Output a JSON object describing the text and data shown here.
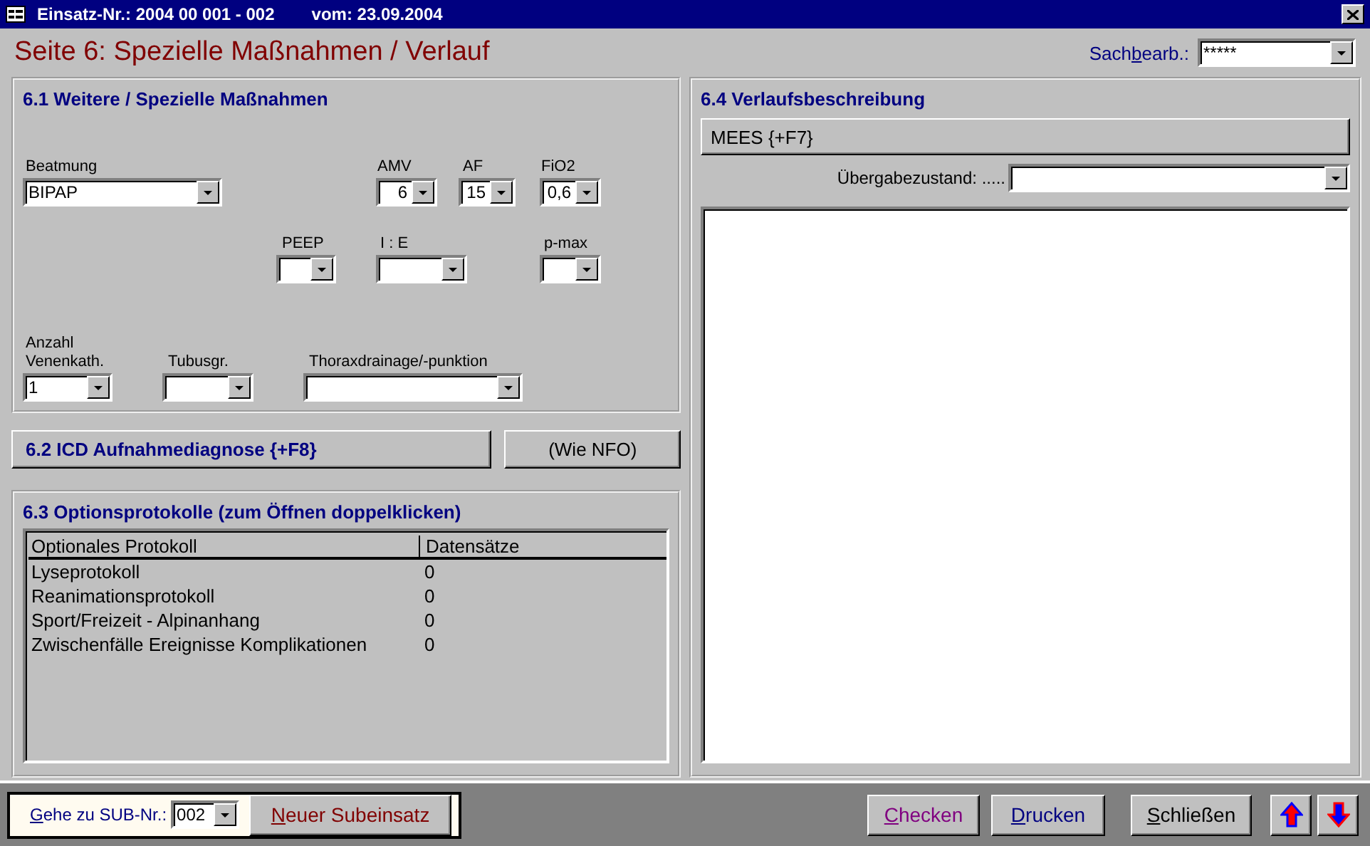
{
  "window": {
    "title": "Einsatz-Nr.: 2004 00 001 - 002",
    "date": "vom: 23.09.2004"
  },
  "page_title": "Seite 6: Spezielle Maßnahmen / Verlauf",
  "clerk": {
    "before": "Sach",
    "mnemonic": "b",
    "rest": "earb.:",
    "value": "*****"
  },
  "section_6_1": {
    "heading": "6.1 Weitere / Spezielle Maßnahmen",
    "fields": [
      {
        "label": "Beatmung",
        "value": "BIPAP"
      },
      {
        "label": "AMV",
        "value": "6"
      },
      {
        "label": "AF",
        "value": "15"
      },
      {
        "label": "FiO2",
        "value": "0,6"
      },
      {
        "label": "PEEP"
      },
      {
        "label": "I : E"
      },
      {
        "label": "p-max"
      },
      {
        "label": "Anzahl Venenkath.",
        "value": "1"
      },
      {
        "label": "Tubusgr."
      },
      {
        "label": "Thoraxdrainage/-punktion"
      }
    ]
  },
  "section_6_2": {
    "button": "6.2 ICD Aufnahmediagnose {+F8}",
    "side_button": "(Wie NFO)"
  },
  "section_6_3": {
    "heading": "6.3 Optionsprotokolle  (zum Öffnen doppelklicken)",
    "columns": [
      "Optionales Protokoll",
      "Datensätze"
    ],
    "rows": [
      [
        "Lyseprotokoll",
        "0"
      ],
      [
        "Reanimationsprotokoll",
        "0"
      ],
      [
        "Sport/Freizeit - Alpinanhang",
        "0"
      ],
      [
        "Zwischenfälle Ereignisse Komplikationen",
        "0"
      ]
    ]
  },
  "section_6_4": {
    "heading": "6.4 Verlaufsbeschreibung",
    "button": "MEES {+F7}",
    "handover_label": "Übergabezustand: ....."
  },
  "footer": {
    "goto": {
      "mnemonic": "G",
      "rest": "ehe zu SUB-Nr.:",
      "value": "002"
    },
    "new_button": {
      "mnemonic": "N",
      "rest": "euer Subeinsatz",
      "color": "#800000"
    },
    "buttons": [
      {
        "mnemonic": "C",
        "rest": "hecken",
        "color": "#800080"
      },
      {
        "mnemonic": "D",
        "rest": "rucken",
        "color": "#000080"
      },
      {
        "mnemonic": "S",
        "rest": "chließen",
        "color": "#000000"
      }
    ],
    "nav": [
      {
        "kind": "up"
      },
      {
        "kind": "down"
      }
    ]
  }
}
